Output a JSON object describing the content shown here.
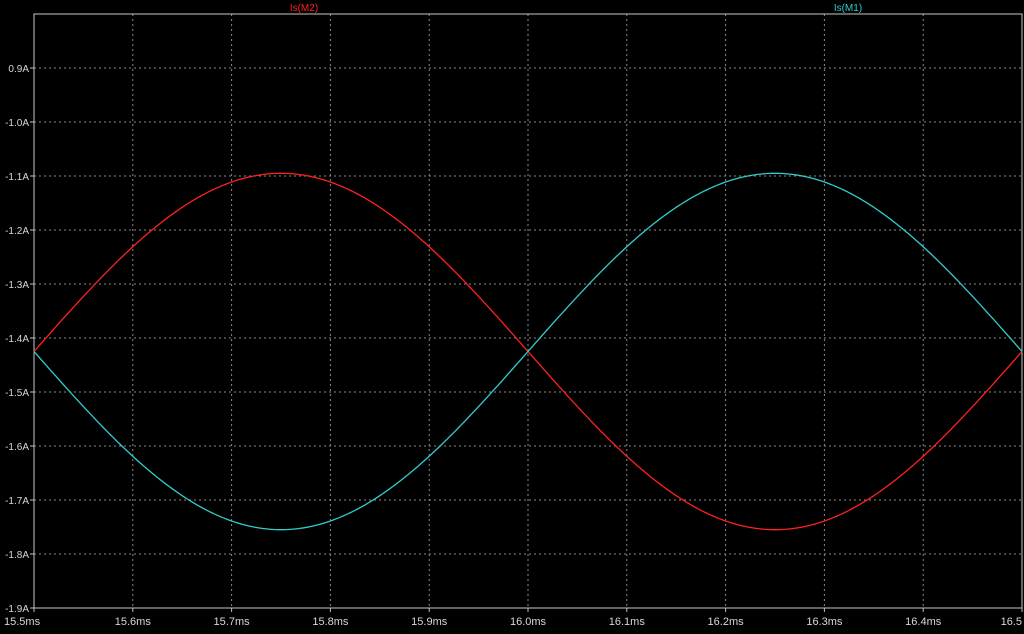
{
  "chart_data": {
    "type": "line",
    "x_unit": "ms",
    "y_unit": "A",
    "xlim": [
      15.5,
      16.5
    ],
    "ylim": [
      -1.9,
      -0.8
    ],
    "x_ticks": [
      15.5,
      15.6,
      15.7,
      15.8,
      15.9,
      16.0,
      16.1,
      16.2,
      16.3,
      16.4,
      16.5
    ],
    "x_tick_labels": [
      "15.5ms",
      "15.6ms",
      "15.7ms",
      "15.8ms",
      "15.9ms",
      "16.0ms",
      "16.1ms",
      "16.2ms",
      "16.3ms",
      "16.4ms",
      "16.5"
    ],
    "y_ticks": [
      -0.9,
      -1.0,
      -1.1,
      -1.2,
      -1.3,
      -1.4,
      -1.5,
      -1.6,
      -1.7,
      -1.8,
      -1.9
    ],
    "y_tick_labels": [
      "0.9A",
      "-1.0A",
      "-1.1A",
      "-1.2A",
      "-1.3A",
      "-1.4A",
      "-1.5A",
      "-1.6A",
      "-1.7A",
      "-1.8A",
      "-1.9A"
    ],
    "grid": true,
    "legend_placement": "top",
    "series": [
      {
        "name": "Is(M2)",
        "color": "#ff2020",
        "x": [
          15.5,
          15.525,
          15.55,
          15.575,
          15.6,
          15.625,
          15.65,
          15.675,
          15.7,
          15.725,
          15.75,
          15.775,
          15.8,
          15.825,
          15.85,
          15.875,
          15.9,
          15.925,
          15.95,
          15.975,
          16.0,
          16.025,
          16.05,
          16.075,
          16.1,
          16.125,
          16.15,
          16.175,
          16.2,
          16.225,
          16.25,
          16.275,
          16.3,
          16.325,
          16.35,
          16.375,
          16.4,
          16.425,
          16.45,
          16.475,
          16.5
        ],
        "y": [
          -1.408,
          -1.358,
          -1.309,
          -1.263,
          -1.22,
          -1.182,
          -1.151,
          -1.126,
          -1.108,
          -1.098,
          -1.095,
          -1.098,
          -1.108,
          -1.126,
          -1.151,
          -1.182,
          -1.22,
          -1.263,
          -1.309,
          -1.358,
          -1.408,
          -1.458,
          -1.507,
          -1.553,
          -1.596,
          -1.634,
          -1.665,
          -1.69,
          -1.708,
          -1.718,
          -1.755,
          -1.718,
          -1.708,
          -1.69,
          -1.665,
          -1.634,
          -1.596,
          -1.553,
          -1.507,
          -1.458,
          -1.408
        ]
      },
      {
        "name": "Is(M1)",
        "color": "#33cccc",
        "x": [
          15.5,
          15.525,
          15.55,
          15.575,
          15.6,
          15.625,
          15.65,
          15.675,
          15.7,
          15.725,
          15.75,
          15.775,
          15.8,
          15.825,
          15.85,
          15.875,
          15.9,
          15.925,
          15.95,
          15.975,
          16.0,
          16.025,
          16.05,
          16.075,
          16.1,
          16.125,
          16.15,
          16.175,
          16.2,
          16.225,
          16.25,
          16.275,
          16.3,
          16.325,
          16.35,
          16.375,
          16.4,
          16.425,
          16.45,
          16.475,
          16.5
        ],
        "y": [
          -1.408,
          -1.458,
          -1.507,
          -1.553,
          -1.596,
          -1.634,
          -1.665,
          -1.69,
          -1.708,
          -1.718,
          -1.755,
          -1.718,
          -1.708,
          -1.69,
          -1.665,
          -1.634,
          -1.596,
          -1.553,
          -1.507,
          -1.458,
          -1.408,
          -1.358,
          -1.309,
          -1.263,
          -1.22,
          -1.182,
          -1.151,
          -1.126,
          -1.108,
          -1.098,
          -1.095,
          -1.098,
          -1.108,
          -1.126,
          -1.151,
          -1.182,
          -1.22,
          -1.263,
          -1.309,
          -1.358,
          -1.408
        ]
      }
    ]
  }
}
